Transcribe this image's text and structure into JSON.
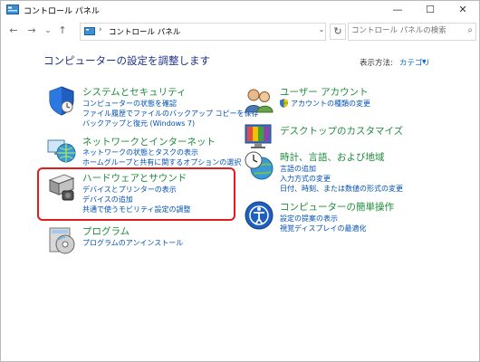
{
  "window": {
    "title": "コントロール パネル",
    "controls": {
      "minimize": "—",
      "maximize": "☐",
      "close": "✕"
    }
  },
  "nav": {
    "back": "←",
    "forward": "→",
    "recent": "⌄",
    "up": "↑",
    "breadcrumb_sep": "›",
    "address": "コントロール パネル",
    "dropdown": "⌄",
    "refresh": "↻",
    "search_placeholder": "コントロール パネルの検索",
    "search_icon": "⌕"
  },
  "main": {
    "title": "コンピューターの設定を調整します",
    "view_by_label": "表示方法:",
    "view_by_value": "カテゴリ",
    "view_by_arrow": "▼"
  },
  "categories": {
    "system": {
      "title": "システムとセキュリティ",
      "links": [
        "コンピューターの状態を確認",
        "ファイル履歴でファイルのバックアップ コピーを保存",
        "バックアップと復元 (Windows 7)"
      ]
    },
    "network": {
      "title": "ネットワークとインターネット",
      "links": [
        "ネットワークの状態とタスクの表示",
        "ホームグループと共有に関するオプションの選択"
      ]
    },
    "hardware": {
      "title": "ハードウェアとサウンド",
      "links": [
        "デバイスとプリンターの表示",
        "デバイスの追加",
        "共通で使うモビリティ設定の調整"
      ]
    },
    "programs": {
      "title": "プログラム",
      "links": [
        "プログラムのアンインストール"
      ]
    },
    "user": {
      "title": "ユーザー アカウント",
      "links": [
        "アカウントの種類の変更"
      ]
    },
    "desktop": {
      "title": "デスクトップのカスタマイズ",
      "links": []
    },
    "clock": {
      "title": "時計、言語、および地域",
      "links": [
        "言語の追加",
        "入力方式の変更",
        "日付、時刻、または数値の形式の変更"
      ]
    },
    "ease": {
      "title": "コンピューターの簡単操作",
      "links": [
        "設定の提案の表示",
        "視覚ディスプレイの最適化"
      ]
    }
  },
  "colors": {
    "title_blue": "#1e3287",
    "category_green": "#1e8c3c",
    "link_blue": "#0050b4",
    "highlight_red": "#e01c1c"
  }
}
